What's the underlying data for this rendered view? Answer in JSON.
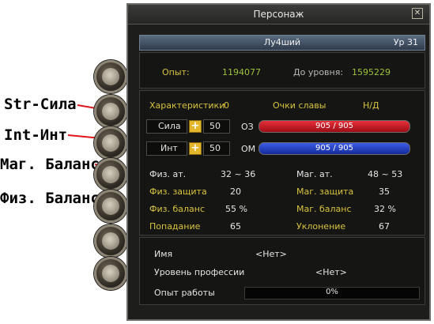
{
  "annotations": {
    "str": "Str-Сила",
    "int": "Int-Инт",
    "mag_balance": "Маг. Баланс",
    "phys_balance": "Физ. Баланс"
  },
  "window": {
    "title": "Персонаж",
    "close_icon": "close-icon"
  },
  "character": {
    "name": "Лу4ший",
    "level": "Ур 31",
    "exp_label": "Опыт:",
    "exp_value": "1194077",
    "next_label": "До уровня:",
    "next_value": "1595229"
  },
  "stats": {
    "header": "Характеристики",
    "free_points": "0",
    "glory_label": "Очки славы",
    "glory_value": "Н/Д",
    "str_label": "Сила",
    "str_value": "50",
    "int_label": "Инт",
    "int_value": "50",
    "hp_label": "ОЗ",
    "hp_value": "905 / 905",
    "mp_label": "ОМ",
    "mp_value": "905 / 905",
    "colors": {
      "hp": "#c5121f",
      "mp": "#1f3dc0",
      "label": "#d8c33e"
    }
  },
  "combat": {
    "left": [
      {
        "label": "Физ. ат.",
        "value": "32 ~ 36"
      },
      {
        "label": "Физ. защита",
        "value": "20"
      },
      {
        "label": "Физ. баланс",
        "value": "55 %"
      },
      {
        "label": "Попадание",
        "value": "65"
      }
    ],
    "right": [
      {
        "label": "Маг. ат.",
        "value": "48 ~ 53"
      },
      {
        "label": "Маг. защита",
        "value": "35"
      },
      {
        "label": "Маг. баланс",
        "value": "32 %"
      },
      {
        "label": "Уклонение",
        "value": "67"
      }
    ]
  },
  "profession": {
    "name_label": "Имя",
    "name_value": "<Нет>",
    "level_label": "Уровень профессии",
    "level_value": "<Нет>",
    "exp_label": "Опыт работы",
    "exp_value": "0%",
    "exp_progress": 0
  },
  "side_icons": [
    "portrait-icon",
    "skills-icon",
    "hand-icon",
    "hand-icon",
    "hand-icon",
    "hand-icon",
    "hand-icon"
  ]
}
